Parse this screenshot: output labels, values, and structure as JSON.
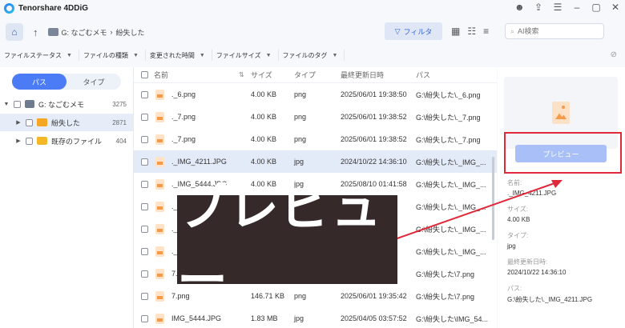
{
  "app": {
    "title": "Tenorshare 4DDiG"
  },
  "breadcrumb": {
    "drive": "G: なごむメモ",
    "sep": "›",
    "folder": "紛失した"
  },
  "toolbar": {
    "filter_label": "フィルタ",
    "search_placeholder": "AI検索"
  },
  "filters": [
    "ファイルステータス",
    "ファイルの種類",
    "変更された時間",
    "ファイルサイズ",
    "ファイルのタグ"
  ],
  "left_tabs": [
    "パス",
    "タイプ"
  ],
  "tree": [
    {
      "label": "G: なごむメモ",
      "count": "3275"
    },
    {
      "label": "紛失した",
      "count": "2871"
    },
    {
      "label": "既存のファイル",
      "count": "404"
    }
  ],
  "columns": {
    "name": "名前",
    "size": "サイズ",
    "type": "タイプ",
    "date": "最終更新日時",
    "path": "パス"
  },
  "rows": [
    {
      "name": "._6.png",
      "size": "4.00 KB",
      "type": "png",
      "date": "2025/06/01 19:38:50",
      "path": "G:\\紛失した\\._6.png"
    },
    {
      "name": "._7.png",
      "size": "4.00 KB",
      "type": "png",
      "date": "2025/06/01 19:38:52",
      "path": "G:\\紛失した\\._7.png"
    },
    {
      "name": "._7.png",
      "size": "4.00 KB",
      "type": "png",
      "date": "2025/06/01 19:38:52",
      "path": "G:\\紛失した\\._7.png"
    },
    {
      "name": "._IMG_4211.JPG",
      "size": "4.00 KB",
      "type": "jpg",
      "date": "2024/10/22 14:36:10",
      "path": "G:\\紛失した\\._IMG_..."
    },
    {
      "name": "._IMG_5444.JPG",
      "size": "4.00 KB",
      "type": "jpg",
      "date": "2025/08/10 01:41:58",
      "path": "G:\\紛失した\\._IMG_..."
    },
    {
      "name": "._",
      "size": "",
      "type": "",
      "date": "00",
      "path": "G:\\紛失した\\._IMG_..."
    },
    {
      "name": "._",
      "size": "",
      "type": "",
      "date": "02",
      "path": "G:\\紛失した\\._IMG_..."
    },
    {
      "name": "._",
      "size": "",
      "type": "",
      "date": "02",
      "path": "G:\\紛失した\\._IMG_..."
    },
    {
      "name": "7.",
      "size": "",
      "type": "",
      "date": "42",
      "path": "G:\\紛失した\\7.png"
    },
    {
      "name": "7.png",
      "size": "146.71 KB",
      "type": "png",
      "date": "2025/06/01 19:35:42",
      "path": "G:\\紛失した\\7.png"
    },
    {
      "name": "IMG_5444.JPG",
      "size": "1.83 MB",
      "type": "jpg",
      "date": "2025/04/05 03:57:52",
      "path": "G:\\紛失した\\IMG_54..."
    }
  ],
  "preview": {
    "button": "プレビュー",
    "name_label": "名前:",
    "name": "._IMG_4211.JPG",
    "size_label": "サイズ:",
    "size": "4.00 KB",
    "type_label": "タイプ:",
    "type": "jpg",
    "date_label": "最終更新日時:",
    "date": "2024/10/22 14:36:10",
    "path_label": "パス:",
    "path": "G:\\紛失した\\._IMG_4211.JPG"
  },
  "overlay": {
    "text": "プレビュー"
  },
  "colors": {
    "accent": "#4b7bf5",
    "highlight": "#e0293a",
    "overlay_bg": "#35292a"
  }
}
